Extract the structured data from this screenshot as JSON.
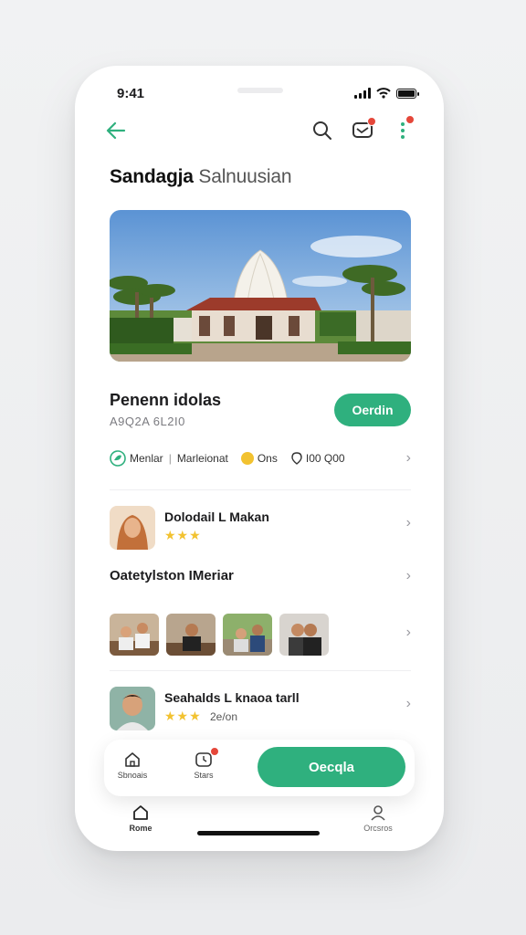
{
  "status_bar": {
    "time": "9:41"
  },
  "header": {
    "title_bold": "Sandagja",
    "title_light": "Salnuusian"
  },
  "place": {
    "name": "Penenn idolas",
    "code": "A9Q2A 6L2I0",
    "open_label": "Oerdin",
    "meta": {
      "category": "Menlar",
      "type": "Marleionat",
      "rating_label": "Ons",
      "distance": "I00 Q00"
    }
  },
  "reviews": [
    {
      "name": "Dolodail L Makan",
      "stars": "★★★",
      "extra": ""
    },
    {
      "name": "Seahalds L knaoa tarll",
      "stars": "★★★",
      "extra": "2e/on"
    }
  ],
  "gallery": {
    "title": "Oatetylston IMeriar"
  },
  "action_bar": {
    "item1_label": "Sbnoais",
    "item2_label": "Stars",
    "cta_label": "Oecqla"
  },
  "tabs": {
    "home_label": "Rome",
    "profile_label": "Orcsros"
  },
  "colors": {
    "accent": "#2fb07e",
    "badge": "#e5473a",
    "star": "#f2c230"
  }
}
